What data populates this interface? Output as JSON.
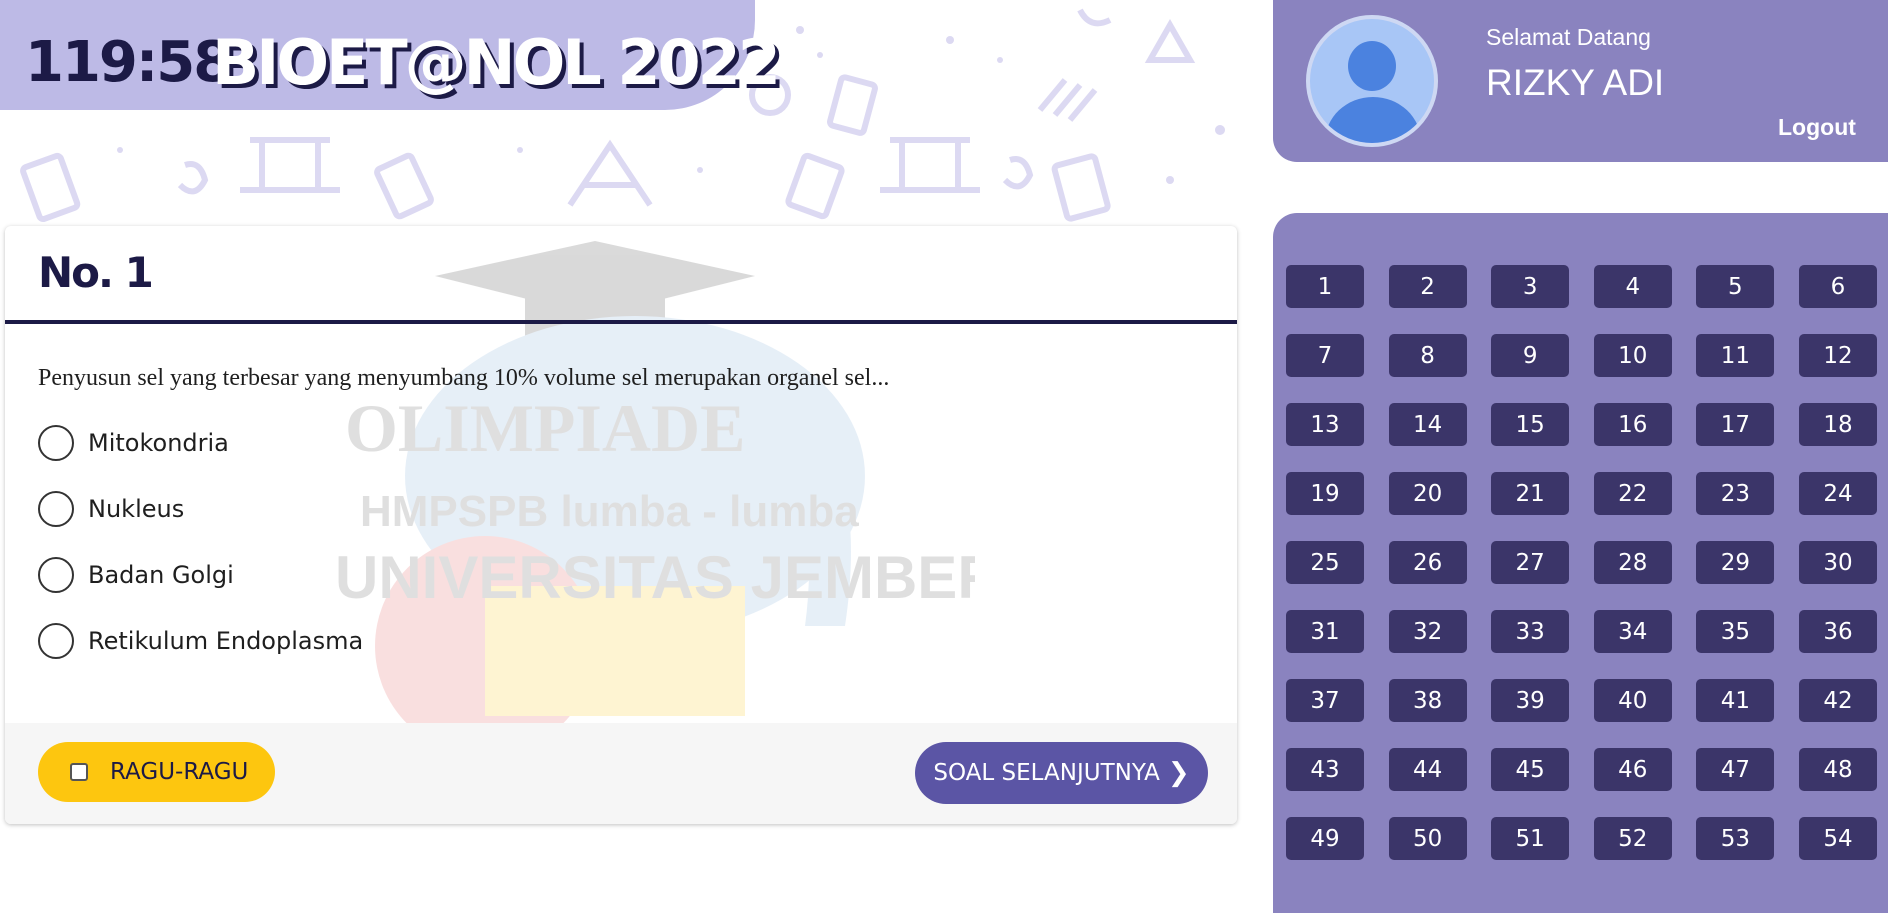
{
  "header": {
    "timer": "119:58",
    "title": "BIOET@NOL 2022"
  },
  "user": {
    "greeting": "Selamat Datang",
    "name": "RIZKY ADI",
    "logout_label": "Logout"
  },
  "question": {
    "number_label": "No. 1",
    "text": "Penyusun sel yang terbesar yang menyumbang 10% volume sel  merupakan organel sel...",
    "options": [
      "Mitokondria",
      "Nukleus",
      "Badan Golgi",
      "Retikulum Endoplasma"
    ],
    "watermark_lines": [
      "OLIMPIADE",
      "HMPSPB lumba - lumba",
      "UNIVERSITAS JEMBER"
    ]
  },
  "footer": {
    "ragu_label": "RAGU-RAGU",
    "next_label": "SOAL SELANJUTNYA",
    "next_icon": "chevron-right-icon"
  },
  "nav": {
    "numbers": [
      "1",
      "2",
      "3",
      "4",
      "5",
      "6",
      "7",
      "8",
      "9",
      "10",
      "11",
      "12",
      "13",
      "14",
      "15",
      "16",
      "17",
      "18",
      "19",
      "20",
      "21",
      "22",
      "23",
      "24",
      "25",
      "26",
      "27",
      "28",
      "29",
      "30",
      "31",
      "32",
      "33",
      "34",
      "35",
      "36",
      "37",
      "38",
      "39",
      "40",
      "41",
      "42",
      "43",
      "44",
      "45",
      "46",
      "47",
      "48",
      "49",
      "50",
      "51",
      "52",
      "53",
      "54"
    ]
  },
  "colors": {
    "banner": "#bdbae6",
    "panel": "#8a83bf",
    "nav_button": "#3b3569",
    "dark_text": "#1c1a46",
    "ragu_button": "#fdc60f",
    "next_button": "#5b55a5"
  }
}
